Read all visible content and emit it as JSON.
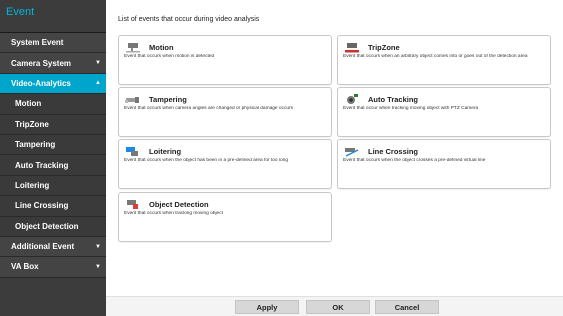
{
  "sidebar": {
    "title": "Event",
    "items": [
      {
        "label": "System Event",
        "arrow": ""
      },
      {
        "label": "Camera System",
        "arrow": "▼"
      },
      {
        "label": "Video-Analytics",
        "arrow": "▲"
      },
      {
        "label": "Motion",
        "arrow": ""
      },
      {
        "label": "TripZone",
        "arrow": ""
      },
      {
        "label": "Tampering",
        "arrow": ""
      },
      {
        "label": "Auto Tracking",
        "arrow": ""
      },
      {
        "label": "Loitering",
        "arrow": ""
      },
      {
        "label": "Line Crossing",
        "arrow": ""
      },
      {
        "label": "Object Detection",
        "arrow": ""
      },
      {
        "label": "Additional Event",
        "arrow": "▼"
      },
      {
        "label": "VA Box",
        "arrow": "▼"
      }
    ]
  },
  "main": {
    "title": "List of events that occur during video analysis",
    "cards": [
      {
        "title": "Motion",
        "desc": "Event that occurs when motion is detected",
        "icon": "motion-camera-icon"
      },
      {
        "title": "TripZone",
        "desc": "Event that occurs when an arbitrary object comes into or goes out of the detection area",
        "icon": "tripzone-camera-icon"
      },
      {
        "title": "Tampering",
        "desc": "Event that occurs when camera angles are changed or physical damage occurs",
        "icon": "tampering-camera-icon"
      },
      {
        "title": "Auto Tracking",
        "desc": "Event that occur when tracking moving object with PTZ Camera",
        "icon": "auto-tracking-icon"
      },
      {
        "title": "Loitering",
        "desc": "Event that occurs when the object has been in a pre-defined area for too long",
        "icon": "loitering-icon"
      },
      {
        "title": "Line Crossing",
        "desc": "Event that occurs when the object crosses a pre-defined virtual line",
        "icon": "line-crossing-icon"
      },
      {
        "title": "Object Detection",
        "desc": "Event that occurs when tracking moving object",
        "icon": "object-detection-icon"
      }
    ]
  },
  "footer": {
    "apply": "Apply",
    "ok": "OK",
    "cancel": "Cancel"
  },
  "colors": {
    "accent": "#00a5cc",
    "sidebar_bg": "#3c3c3c",
    "header_text": "#00b5d8"
  }
}
